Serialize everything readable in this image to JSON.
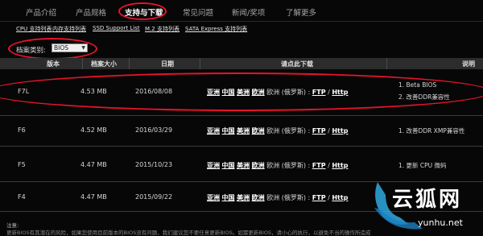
{
  "nav": {
    "tabs": [
      {
        "label": "产品介绍",
        "active": false
      },
      {
        "label": "产品规格",
        "active": false
      },
      {
        "label": "支持与下载",
        "active": true
      },
      {
        "label": "常见问题",
        "active": false
      },
      {
        "label": "新闻/奖项",
        "active": false
      },
      {
        "label": "了解更多",
        "active": false
      }
    ]
  },
  "sublinks": [
    "CPU 支持列表",
    "内存支持列表",
    "SSD Support List",
    "M.2 支持列表",
    "SATA Express 支持列表"
  ],
  "filter": {
    "label": "档案类别:",
    "value": "BIOS"
  },
  "table": {
    "headers": {
      "version": "版本",
      "size": "档案大小",
      "date": "日期",
      "download": "请点此下载",
      "desc": "说明"
    },
    "rows": [
      {
        "version": "F7L",
        "size": "4.53 MB",
        "date": "2016/08/08",
        "desc1": "1. Beta BIOS",
        "desc2": "2. 改善DDR兼容性"
      },
      {
        "version": "F6",
        "size": "4.52 MB",
        "date": "2016/03/29",
        "desc1": "1. 改善DDR XMP兼容性",
        "desc2": ""
      },
      {
        "version": "F5",
        "size": "4.47 MB",
        "date": "2015/10/23",
        "desc1": "1. 更新 CPU 微码",
        "desc2": ""
      },
      {
        "version": "F4",
        "size": "4.47 MB",
        "date": "2015/09/22",
        "desc1": "",
        "desc2": ""
      }
    ],
    "download_links": [
      "亚洲",
      "中国",
      "美洲",
      "欧洲"
    ],
    "download_plain": "欧洲 (俄罗斯) :",
    "ftp": "FTP",
    "http": "Http",
    "sep": "/"
  },
  "notes": {
    "title": "注意:",
    "line": "更新BIOS有其潜在的风险，如果您使用目前版本的BIOS没有问题，我们建议您不要任意更新BIOS。如需更新BIOS，请小心的执行，以避免不当的操作所造成"
  },
  "watermark": {
    "cn": "云狐网",
    "url": "yunhu.net"
  },
  "colors": {
    "annotation": "#e8132a",
    "background": "#070707",
    "header_bg": "#2c2c2c"
  }
}
